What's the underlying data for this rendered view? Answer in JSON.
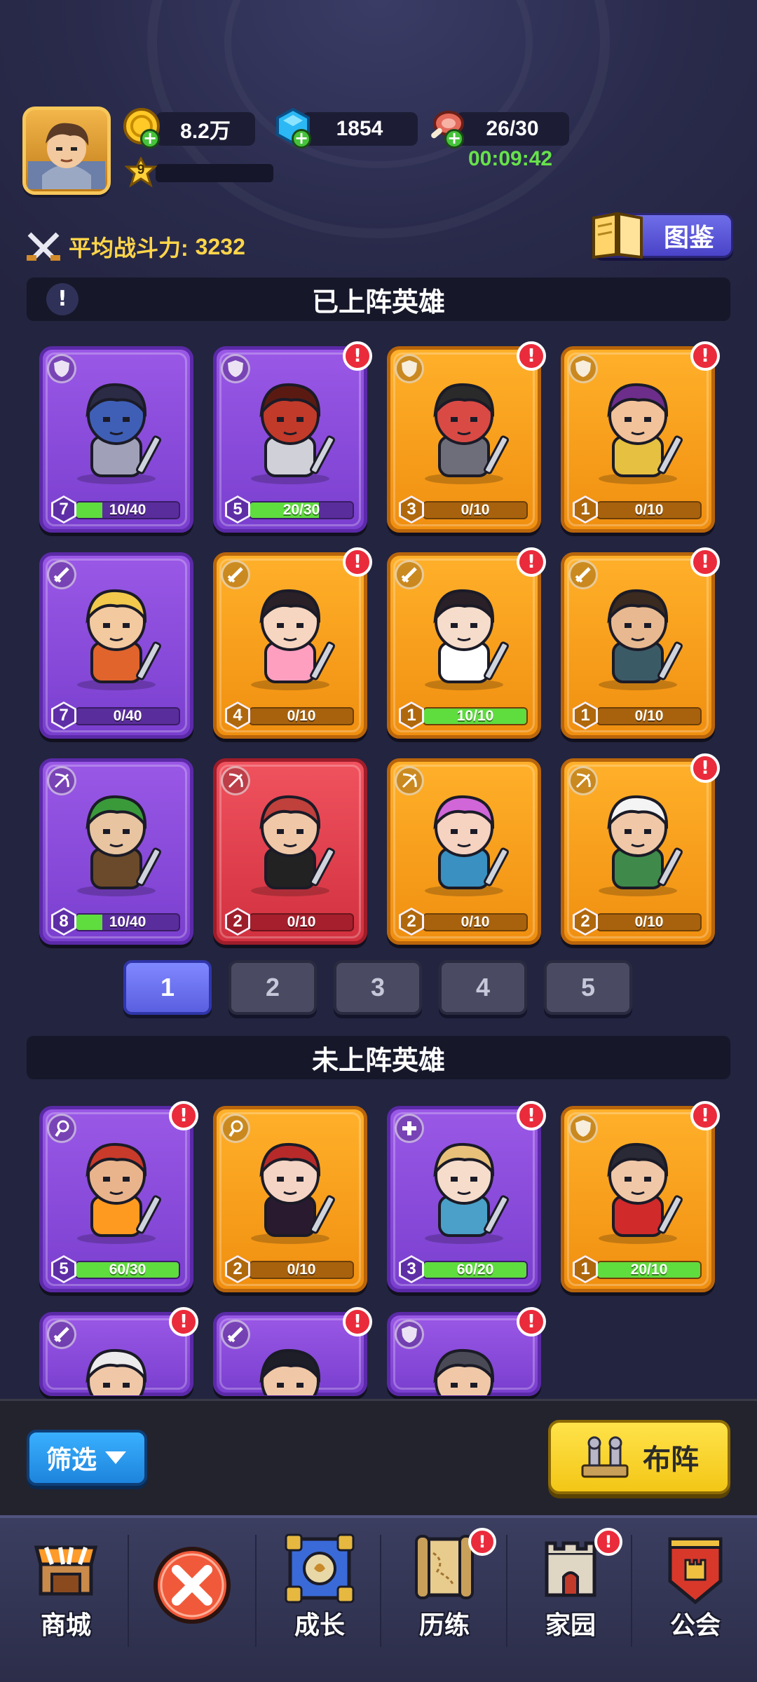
{
  "header": {
    "gold": "8.2万",
    "gems": "1854",
    "stamina": "26/30",
    "stamina_timer": "00:09:42",
    "player_level": "9",
    "avg_power_label": "平均战斗力:",
    "avg_power_value": "3232",
    "codex_label": "图鉴"
  },
  "deployed": {
    "title": "已上阵英雄",
    "heroes": [
      {
        "rarity": "purple",
        "class_icon": "shield-icon",
        "alert": false,
        "stars": "7",
        "progress": "10/40",
        "fill": 0.25,
        "figure": "minotaur"
      },
      {
        "rarity": "purple",
        "class_icon": "shield-icon",
        "alert": true,
        "stars": "5",
        "progress": "20/30",
        "fill": 0.67,
        "figure": "red-bull"
      },
      {
        "rarity": "orange",
        "class_icon": "shield-icon",
        "alert": true,
        "stars": "3",
        "progress": "0/10",
        "fill": 0,
        "figure": "red-warrior"
      },
      {
        "rarity": "orange",
        "class_icon": "shield-icon",
        "alert": true,
        "stars": "1",
        "progress": "0/10",
        "fill": 0,
        "figure": "bearded-brawler"
      },
      {
        "rarity": "purple",
        "class_icon": "sword-icon",
        "alert": false,
        "stars": "7",
        "progress": "0/40",
        "fill": 0,
        "figure": "blond-knight"
      },
      {
        "rarity": "orange",
        "class_icon": "sword-icon",
        "alert": true,
        "stars": "4",
        "progress": "0/10",
        "fill": 0,
        "figure": "bunny-girl"
      },
      {
        "rarity": "orange",
        "class_icon": "sword-icon",
        "alert": true,
        "stars": "1",
        "progress": "10/10",
        "fill": 1,
        "figure": "white-swordswoman"
      },
      {
        "rarity": "orange",
        "class_icon": "sword-icon",
        "alert": true,
        "stars": "1",
        "progress": "0/10",
        "fill": 0,
        "figure": "bearded-swordsman"
      },
      {
        "rarity": "purple",
        "class_icon": "bow-icon",
        "alert": false,
        "stars": "8",
        "progress": "10/40",
        "fill": 0.25,
        "figure": "green-archer"
      },
      {
        "rarity": "red",
        "class_icon": "bow-icon",
        "alert": false,
        "stars": "2",
        "progress": "0/10",
        "fill": 0,
        "figure": "red-hair-boy"
      },
      {
        "rarity": "orange",
        "class_icon": "bow-icon",
        "alert": false,
        "stars": "2",
        "progress": "0/10",
        "fill": 0,
        "figure": "pink-hair-gunner"
      },
      {
        "rarity": "orange",
        "class_icon": "bow-icon",
        "alert": true,
        "stars": "2",
        "progress": "0/10",
        "fill": 0,
        "figure": "white-beard-archer"
      }
    ]
  },
  "pagination": {
    "pages": [
      "1",
      "2",
      "3",
      "4",
      "5"
    ],
    "active": "1"
  },
  "undeployed": {
    "title": "未上阵英雄",
    "heroes": [
      {
        "rarity": "purple",
        "class_icon": "staff-icon",
        "alert": true,
        "stars": "5",
        "progress": "60/30",
        "fill": 1,
        "figure": "fire-mage"
      },
      {
        "rarity": "orange",
        "class_icon": "staff-icon",
        "alert": false,
        "stars": "2",
        "progress": "0/10",
        "fill": 0,
        "figure": "red-hood"
      },
      {
        "rarity": "purple",
        "class_icon": "heal-icon",
        "alert": true,
        "stars": "3",
        "progress": "60/20",
        "fill": 1,
        "figure": "blue-priestess"
      },
      {
        "rarity": "orange",
        "class_icon": "shield-icon",
        "alert": true,
        "stars": "1",
        "progress": "20/10",
        "fill": 1,
        "figure": "dark-knight"
      },
      {
        "rarity": "purple",
        "class_icon": "sword-icon",
        "alert": true,
        "figure": "white-hair-warrior"
      },
      {
        "rarity": "purple",
        "class_icon": "sword-icon",
        "alert": true,
        "figure": "masked-ninja"
      },
      {
        "rarity": "purple",
        "class_icon": "shield-icon",
        "alert": true,
        "figure": "viking"
      }
    ]
  },
  "actions": {
    "filter_label": "筛选",
    "deploy_label": "布阵"
  },
  "nav": [
    {
      "label": "商城",
      "icon": "shop-icon",
      "alert": false
    },
    {
      "label": "",
      "icon": "close-icon",
      "alert": false
    },
    {
      "label": "成长",
      "icon": "growth-icon",
      "alert": false
    },
    {
      "label": "历练",
      "icon": "adventure-map-icon",
      "alert": true
    },
    {
      "label": "家园",
      "icon": "home-castle-icon",
      "alert": true
    },
    {
      "label": "公会",
      "icon": "guild-banner-icon",
      "alert": false
    }
  ],
  "colors": {
    "purple": "#8b4de0",
    "orange": "#f8a11e",
    "red": "#e23f4d",
    "progress_fill": "#5fdc3e",
    "alert": "#ea2b3b"
  }
}
